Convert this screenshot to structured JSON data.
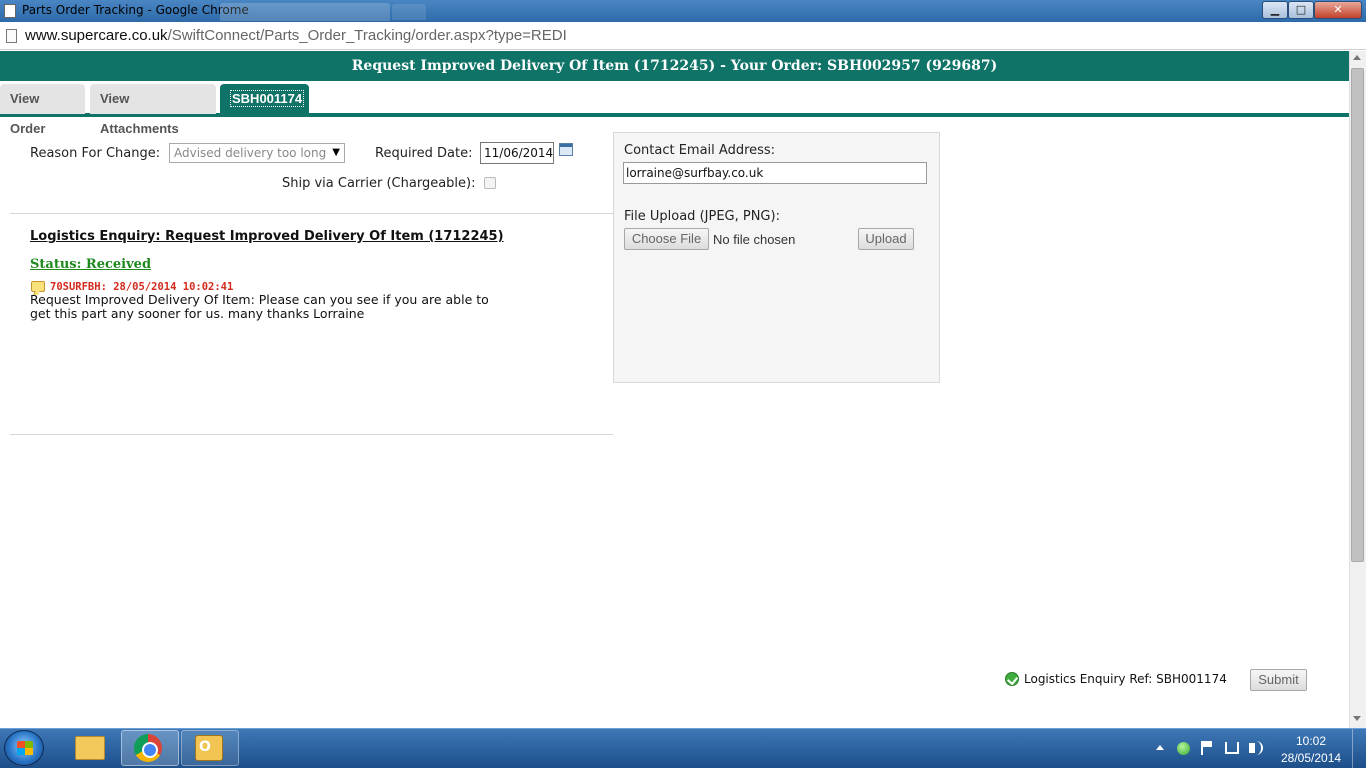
{
  "window": {
    "title": "Parts Order Tracking - Google Chrome",
    "minimize_icon": "minimize-icon",
    "maximize_icon": "maximize-icon",
    "close_label": "✕"
  },
  "address_bar": {
    "host": "www.supercare.co.uk",
    "path": "/SwiftConnect/Parts_Order_Tracking/order.aspx?type=REDI"
  },
  "header": {
    "title": "Request Improved Delivery Of Item (1712245) - Your Order: SBH002957 (929687)"
  },
  "tabs": [
    {
      "label": "View Order",
      "active": false
    },
    {
      "label": "View Attachments",
      "active": false
    },
    {
      "label": "SBH001174",
      "active": true
    }
  ],
  "form": {
    "reason_label": "Reason For Change:",
    "reason_value": "Advised delivery too long",
    "required_date_label": "Required Date:",
    "required_date_value": "11/06/2014",
    "ship_label": "Ship via Carrier (Chargeable):",
    "ship_checked": false
  },
  "enquiry": {
    "title": "Logistics Enquiry: Request Improved Delivery Of Item (1712245)",
    "status": "Status: Received",
    "comment_meta": "70SURFBH: 28/05/2014 10:02:41",
    "comment_body": "Request Improved Delivery Of Item: Please can you see if you are able to get this part any sooner for us. many thanks Lorraine"
  },
  "panel": {
    "email_label": "Contact Email Address:",
    "email_value": "lorraine@surfbay.co.uk",
    "upload_label": "File Upload (JPEG, PNG):",
    "choose_file_label": "Choose File",
    "no_file_text": "No file chosen",
    "upload_button": "Upload"
  },
  "footer": {
    "ref_text": "Logistics Enquiry Ref: SBH001174",
    "submit_label": "Submit"
  },
  "taskbar": {
    "time": "10:02",
    "date": "28/05/2014"
  },
  "colors": {
    "brand_teal": "#0f7367",
    "status_green": "#1e8a1e",
    "comment_red": "#d42a1c"
  }
}
